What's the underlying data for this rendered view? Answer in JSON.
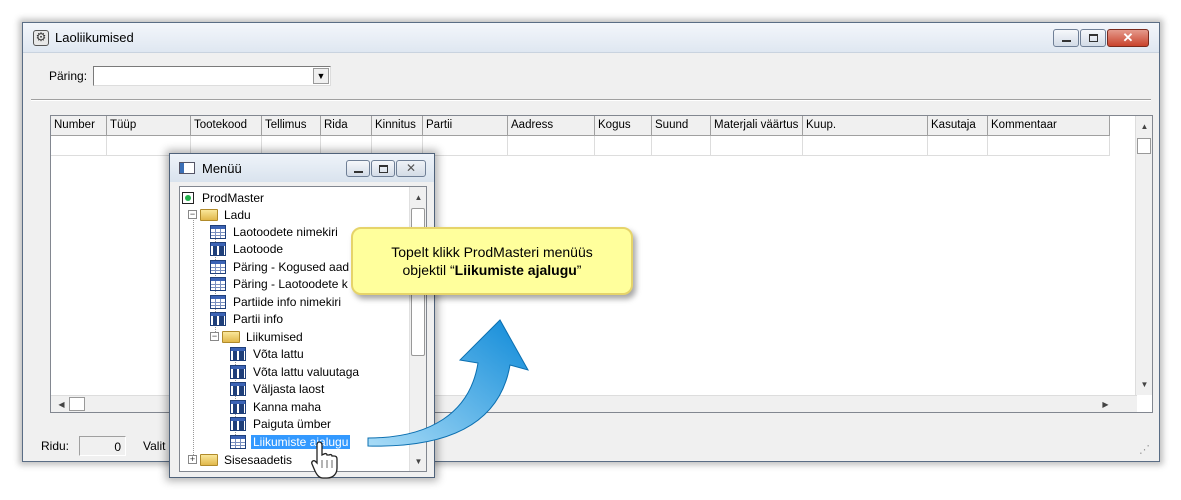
{
  "main_window": {
    "title": "Laoliikumised",
    "query_label": "Päring:",
    "query_value": "",
    "columns": [
      "Number",
      "Tüüp",
      "Tootekood",
      "Tellimus",
      "Rida",
      "Kinnitus",
      "Partii",
      "Aadress",
      "Kogus",
      "Suund",
      "Materjali väärtus",
      "Kuup.",
      "Kasutaja",
      "Kommentaar"
    ],
    "status": {
      "rows_label": "Ridu:",
      "rows_count": "0",
      "selected_label": "Valit"
    }
  },
  "menu_window": {
    "title": "Menüü",
    "tree": {
      "root": "ProdMaster",
      "ladu": "Ladu",
      "items": [
        "Laotoodete nimekiri",
        "Laotoode",
        "Päring - Kogused aad",
        "Päring - Laotoodete k",
        "Partiide info nimekiri",
        "Partii info"
      ],
      "liikumised": "Liikumised",
      "liikumised_items": [
        "Võta lattu",
        "Võta lattu valuutaga",
        "Väljasta laost",
        "Kanna maha",
        "Paiguta ümber",
        "Liikumiste ajalugu"
      ],
      "sisesaadetis": "Sisesaadetis"
    }
  },
  "callout": {
    "line1": "Topelt klikk ProdMasteri menüüs",
    "line2_prefix": "objektil “",
    "line2_bold": "Liikumiste ajalugu",
    "line2_suffix": "”"
  },
  "colors": {
    "callout_bg": "#ffff9c",
    "arrow": "#1f9be6",
    "selection": "#3399ff"
  }
}
